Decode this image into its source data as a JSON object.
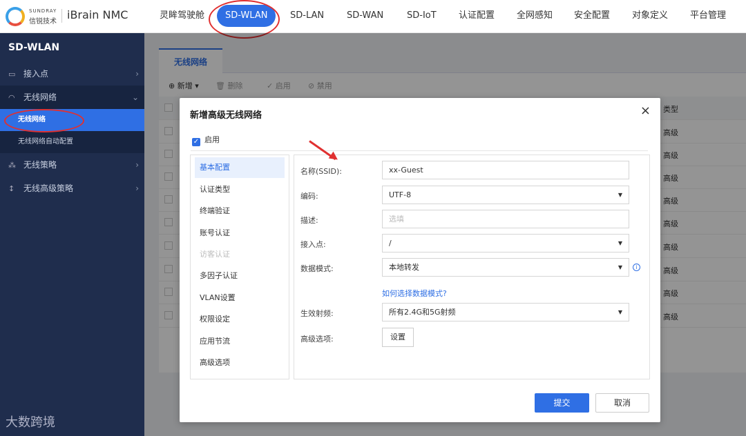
{
  "brand": {
    "en": "SUNDRAY",
    "cn": "信锐技术",
    "product": "iBrain NMC"
  },
  "topnav": [
    {
      "label": "灵眸驾驶舱"
    },
    {
      "label": "SD-WLAN"
    },
    {
      "label": "SD-LAN"
    },
    {
      "label": "SD-WAN"
    },
    {
      "label": "SD-IoT"
    },
    {
      "label": "认证配置"
    },
    {
      "label": "全网感知"
    },
    {
      "label": "安全配置"
    },
    {
      "label": "对象定义"
    },
    {
      "label": "平台管理"
    }
  ],
  "sidebar": {
    "title": "SD-WLAN",
    "items": [
      {
        "label": "接入点",
        "icon": "access-point-icon"
      },
      {
        "label": "无线网络",
        "icon": "wifi-icon"
      },
      {
        "label": "无线策略",
        "icon": "policy-icon"
      },
      {
        "label": "无线高级策略",
        "icon": "advanced-policy-icon"
      }
    ],
    "subitems": [
      {
        "label": "无线网络"
      },
      {
        "label": "无线网络自动配置"
      }
    ]
  },
  "watermark": "大数跨境",
  "tab": {
    "label": "无线网络"
  },
  "toolbar": {
    "new": "新增",
    "delete": "删除",
    "enable": "启用",
    "disable": "禁用"
  },
  "table": {
    "type_header": "类型",
    "rows": [
      "高级",
      "高级",
      "高级",
      "高级",
      "高级",
      "高级",
      "高级",
      "高级",
      "高级"
    ]
  },
  "dialog": {
    "title": "新增高级无线网络",
    "close": "×",
    "enable_label": "启用",
    "leftnav": [
      {
        "label": "基本配置"
      },
      {
        "label": "认证类型"
      },
      {
        "label": "终端验证"
      },
      {
        "label": "账号认证"
      },
      {
        "label": "访客认证"
      },
      {
        "label": "多因子认证"
      },
      {
        "label": "VLAN设置"
      },
      {
        "label": "权限设定"
      },
      {
        "label": "应用节流"
      },
      {
        "label": "高级选项"
      }
    ],
    "form": {
      "ssid_label": "名称(SSID):",
      "ssid_value": "xx-Guest",
      "encoding_label": "编码:",
      "encoding_value": "UTF-8",
      "desc_label": "描述:",
      "desc_placeholder": "选填",
      "ap_label": "接入点:",
      "ap_value": "/",
      "mode_label": "数据模式:",
      "mode_value": "本地转发",
      "mode_help_link": "如何选择数据模式?",
      "freq_label": "生效射频:",
      "freq_value": "所有2.4G和5G射频",
      "advanced_label": "高级选项:",
      "advanced_button": "设置"
    },
    "submit": "提交",
    "cancel": "取消"
  }
}
